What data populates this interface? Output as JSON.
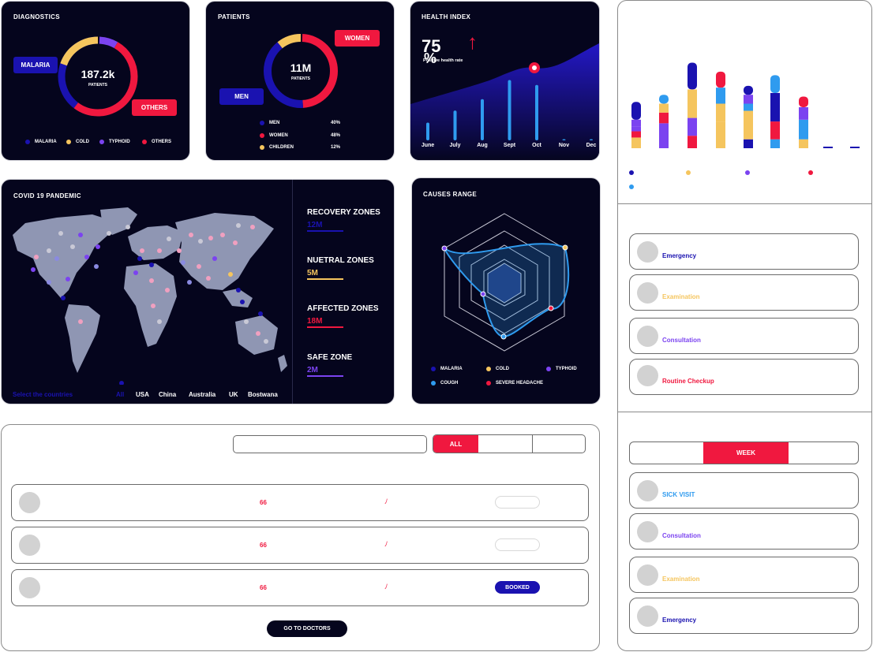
{
  "colors": {
    "panel": "#05051d",
    "navy": "#1a12b0",
    "yellow": "#f5c55e",
    "purple": "#7b43f0",
    "red": "#f0183f",
    "blue": "#2f9bef"
  },
  "diagnostics": {
    "title": "DIAGNOSTICS",
    "center_value": "187.2k",
    "center_caption": "PATIENTS",
    "tag_left": "MALARIA",
    "tag_right": "OTHERS",
    "legend": [
      "MALARIA",
      "COLD",
      "TYPHOID",
      "OTHERS"
    ]
  },
  "patients": {
    "title": "PATIENTS",
    "center_value": "11M",
    "center_caption": "PATIENTS",
    "tag_left": "MEN",
    "tag_right": "WOMEN",
    "rows": [
      {
        "label": "MEN",
        "value": "40%"
      },
      {
        "label": "WOMEN",
        "value": "48%"
      },
      {
        "label": "CHILDREN",
        "value": "12%"
      }
    ]
  },
  "health_index": {
    "title": "HEALTH INDEX",
    "value": "75",
    "unit": "%",
    "caption": "Positive health rate",
    "chart_data": {
      "type": "bar",
      "categories": [
        "June",
        "July",
        "Aug",
        "Sept",
        "Oct",
        "Nov",
        "Dec"
      ],
      "values": [
        25,
        42,
        58,
        85,
        78,
        1,
        1
      ],
      "ylim": [
        0,
        100
      ],
      "grid": false
    }
  },
  "covid": {
    "title": "COVID 19 PANDEMIC",
    "zones": [
      {
        "label": "RECOVERY ZONES",
        "value": "12M",
        "color": "#1a12b0"
      },
      {
        "label": "NUETRAL ZONES",
        "value": "5M",
        "color": "#f5c55e"
      },
      {
        "label": "AFFECTED ZONES",
        "value": "18M",
        "color": "#f0183f"
      },
      {
        "label": "SAFE ZONE",
        "value": "2M",
        "color": "#7b43f0"
      }
    ],
    "select_label": "Select the countries",
    "countries": [
      "All",
      "USA",
      "China",
      "Australia",
      "UK",
      "Bostwana"
    ]
  },
  "causes": {
    "title": "CAUSES RANGE",
    "legend": [
      "MALARIA",
      "COLD",
      "TYPHOID",
      "COUGH",
      "SEVERE HEADACHE"
    ]
  },
  "stacked_chart": {
    "chart_data": {
      "type": "bar",
      "stacked": true,
      "groups": 8,
      "segments": [
        [
          [
            "#f5c55e",
            12
          ],
          [
            "#f0183f",
            7
          ],
          [
            "#7b43f0",
            5
          ],
          [
            "#7b43f0",
            8
          ],
          [
            "#1a12b0",
            20
          ]
        ],
        [
          [
            "#7b43f0",
            28
          ],
          [
            "#f0183f",
            12
          ],
          [
            "#f5c55e",
            10
          ],
          [
            "#2f9bef",
            10
          ]
        ],
        [
          [
            "#f0183f",
            14
          ],
          [
            "#7b43f0",
            20
          ],
          [
            "#f5c55e",
            32
          ],
          [
            "#1a12b0",
            30
          ]
        ],
        [
          [
            "#f5c55e",
            30
          ],
          [
            "#f5c55e",
            20
          ],
          [
            "#2f9bef",
            18
          ],
          [
            "#f0183f",
            18
          ]
        ],
        [
          [
            "#1a12b0",
            10
          ],
          [
            "#f5c55e",
            32
          ],
          [
            "#2f9bef",
            8
          ],
          [
            "#7b43f0",
            10
          ],
          [
            "#1a12b0",
            10
          ]
        ],
        [
          [
            "#2f9bef",
            10
          ],
          [
            "#f0183f",
            20
          ],
          [
            "#1a12b0",
            32
          ],
          [
            "#2f9bef",
            20
          ]
        ],
        [
          [
            "#f5c55e",
            10
          ],
          [
            "#2f9bef",
            22
          ],
          [
            "#7b43f0",
            14
          ],
          [
            "#f0183f",
            12
          ]
        ],
        [
          [
            "#1a12b0",
            1
          ]
        ],
        [
          [
            "#1a12b0",
            1
          ]
        ]
      ]
    }
  },
  "appointments_top": [
    {
      "label": "Emergency",
      "color": "#1a12b0"
    },
    {
      "label": "Examination",
      "color": "#f5c55e"
    },
    {
      "label": "Consultation",
      "color": "#7b43f0"
    },
    {
      "label": "Routine Checkup",
      "color": "#f0183f"
    }
  ],
  "period_tabs": [
    "",
    "WEEK",
    ""
  ],
  "appointments_bottom": [
    {
      "label": "SICK VISIT",
      "color": "#2f9bef"
    },
    {
      "label": "Consultation",
      "color": "#7b43f0"
    },
    {
      "label": "Examination",
      "color": "#f5c55e"
    },
    {
      "label": "Emergency",
      "color": "#1a12b0"
    }
  ],
  "doctors": {
    "filter_tabs": [
      "ALL",
      "",
      ""
    ],
    "rows": [
      {
        "number": "66",
        "status": ""
      },
      {
        "number": "66",
        "status": ""
      },
      {
        "number": "66",
        "status": "BOOKED"
      }
    ],
    "cta": "GO TO DOCTORS"
  }
}
